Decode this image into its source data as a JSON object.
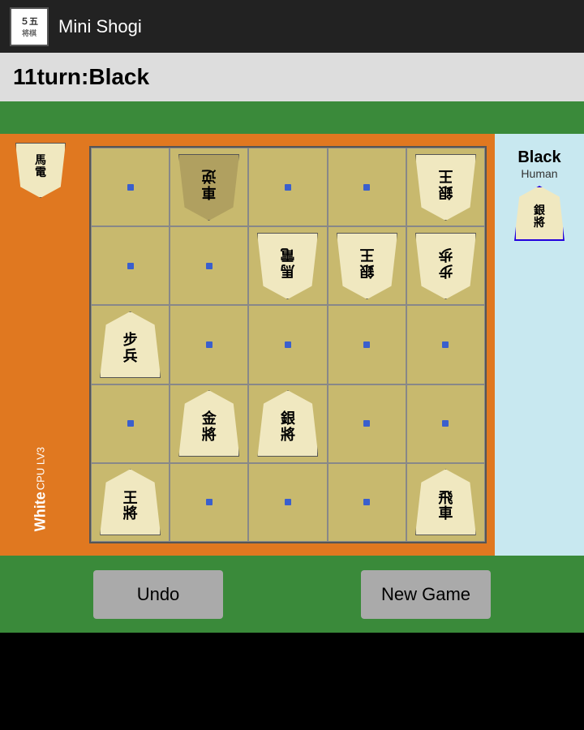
{
  "app": {
    "icon_top": "５五",
    "icon_bottom": "将棋",
    "title": "Mini Shogi"
  },
  "status": {
    "turn_label": "11turn:Black"
  },
  "board": {
    "rows": 5,
    "cols": 5,
    "cells": [
      {
        "row": 0,
        "col": 0,
        "piece": null,
        "dot": true
      },
      {
        "row": 0,
        "col": 1,
        "piece": {
          "text": "車\n逆",
          "color": "dark",
          "side": "white"
        },
        "dot": false
      },
      {
        "row": 0,
        "col": 2,
        "piece": null,
        "dot": true
      },
      {
        "row": 0,
        "col": 3,
        "piece": null,
        "dot": true
      },
      {
        "row": 0,
        "col": 4,
        "piece": {
          "text": "銀\n王",
          "color": "light",
          "side": "white"
        },
        "dot": false
      },
      {
        "row": 1,
        "col": 0,
        "piece": null,
        "dot": true
      },
      {
        "row": 1,
        "col": 1,
        "piece": null,
        "dot": true
      },
      {
        "row": 1,
        "col": 2,
        "piece": {
          "text": "馬\n電",
          "color": "light",
          "side": "white"
        },
        "dot": false
      },
      {
        "row": 1,
        "col": 3,
        "piece": {
          "text": "銀\n王",
          "color": "light",
          "side": "white"
        },
        "dot": false
      },
      {
        "row": 1,
        "col": 4,
        "piece": {
          "text": "步\n歩",
          "color": "light",
          "side": "white"
        },
        "dot": false
      },
      {
        "row": 2,
        "col": 0,
        "piece": {
          "text": "步\n兵",
          "color": "light",
          "side": "black"
        },
        "dot": false
      },
      {
        "row": 2,
        "col": 1,
        "piece": null,
        "dot": true
      },
      {
        "row": 2,
        "col": 2,
        "piece": null,
        "dot": true
      },
      {
        "row": 2,
        "col": 3,
        "piece": null,
        "dot": true
      },
      {
        "row": 2,
        "col": 4,
        "piece": null,
        "dot": true
      },
      {
        "row": 3,
        "col": 0,
        "piece": null,
        "dot": true
      },
      {
        "row": 3,
        "col": 1,
        "piece": {
          "text": "金\n將",
          "color": "light",
          "side": "black"
        },
        "dot": false
      },
      {
        "row": 3,
        "col": 2,
        "piece": {
          "text": "銀\n將",
          "color": "light",
          "side": "black"
        },
        "dot": false
      },
      {
        "row": 3,
        "col": 3,
        "piece": null,
        "dot": true
      },
      {
        "row": 3,
        "col": 4,
        "piece": null,
        "dot": true
      },
      {
        "row": 4,
        "col": 0,
        "piece": {
          "text": "王\n將",
          "color": "light",
          "side": "black"
        },
        "dot": false
      },
      {
        "row": 4,
        "col": 1,
        "piece": null,
        "dot": true
      },
      {
        "row": 4,
        "col": 2,
        "piece": null,
        "dot": true
      },
      {
        "row": 4,
        "col": 3,
        "piece": null,
        "dot": true
      },
      {
        "row": 4,
        "col": 4,
        "piece": {
          "text": "飛\n車",
          "color": "light",
          "side": "black"
        },
        "dot": false
      }
    ]
  },
  "right_panel": {
    "player_label": "Black",
    "player_type": "Human",
    "captured_piece": {
      "text": "銀\n將",
      "selected": true
    }
  },
  "left_panel": {
    "player_label": "White",
    "player_type": "CPU LV3",
    "captured_piece": {
      "text": "馬\n電"
    }
  },
  "buttons": {
    "undo_label": "Undo",
    "new_game_label": "New Game"
  }
}
